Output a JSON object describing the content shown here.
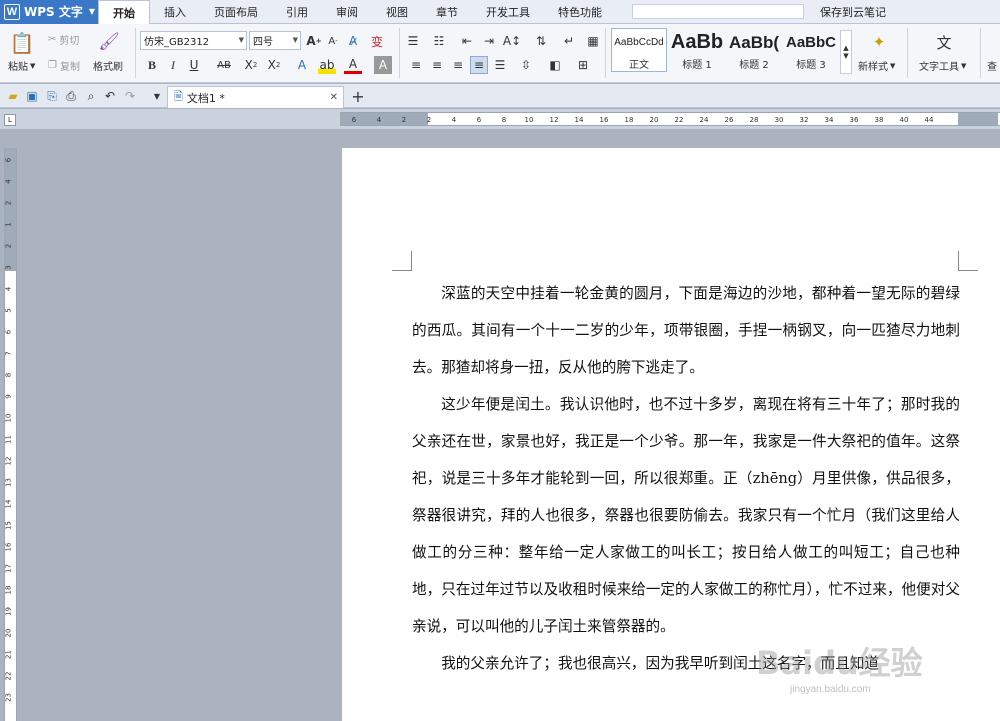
{
  "menubar": {
    "app_name": "WPS 文字",
    "tabs": [
      "开始",
      "插入",
      "页面布局",
      "引用",
      "审阅",
      "视图",
      "章节",
      "开发工具",
      "特色功能"
    ],
    "cloud_save": "保存到云笔记"
  },
  "ribbon": {
    "clipboard": {
      "paste": "粘贴",
      "cut": "剪切",
      "copy": "复制",
      "format_painter": "格式刷"
    },
    "font": {
      "family": "仿宋_GB2312",
      "size": "四号"
    },
    "styles": [
      {
        "sample": "AaBbCcDd",
        "name": "正文"
      },
      {
        "sample": "AaBb",
        "name": "标题 1"
      },
      {
        "sample": "AaBb(",
        "name": "标题 2"
      },
      {
        "sample": "AaBbC",
        "name": "标题 3"
      }
    ],
    "new_style": "新样式",
    "text_tools": "文字工具",
    "cut_off_label": "查"
  },
  "doc_tab": {
    "title": "文档1 *",
    "add": "+"
  },
  "ruler": {
    "h_ticks": [
      "6",
      "4",
      "2",
      "2",
      "4",
      "6",
      "8",
      "10",
      "12",
      "14",
      "16",
      "18",
      "20",
      "22",
      "24",
      "26",
      "28",
      "30",
      "32",
      "34",
      "36",
      "38",
      "40",
      "44"
    ],
    "v_ticks": [
      "6",
      "4",
      "2",
      "1",
      "2",
      "3",
      "4",
      "5",
      "6",
      "7",
      "8",
      "9",
      "10",
      "11",
      "12",
      "13",
      "14",
      "15",
      "16",
      "17",
      "18",
      "19",
      "20",
      "21",
      "22",
      "23",
      "24"
    ]
  },
  "document": {
    "paragraphs": [
      "深蓝的天空中挂着一轮金黄的圆月，下面是海边的沙地，都种着一望无际的碧绿的西瓜。其间有一个十一二岁的少年，项带银圈，手捏一柄钢叉，向一匹猹尽力地刺去。那猹却将身一扭，反从他的胯下逃走了。",
      "这少年便是闰土。我认识他时，也不过十多岁，离现在将有三十年了；那时我的父亲还在世，家景也好，我正是一个少爷。那一年，我家是一件大祭祀的值年。这祭祀，说是三十多年才能轮到一回，所以很郑重。正（zhēng）月里供像，供品很多，祭器很讲究，拜的人也很多，祭器也很要防偷去。我家只有一个忙月（我们这里给人做工的分三种：整年给一定人家做工的叫长工；按日给人做工的叫短工；自己也种地，只在过年过节以及收租时候来给一定的人家做工的称忙月），忙不过来，他便对父亲说，可以叫他的儿子闰土来管祭器的。",
      "我的父亲允许了；我也很高兴，因为我早听到闰土这名字，而且知道"
    ]
  },
  "watermark": {
    "text": "Baidu经验",
    "sub": "jingyan.baidu.com"
  },
  "colors": {
    "accent": "#3a78c7",
    "workspace": "#aab3bf",
    "ribbon": "#f4f6fa"
  }
}
